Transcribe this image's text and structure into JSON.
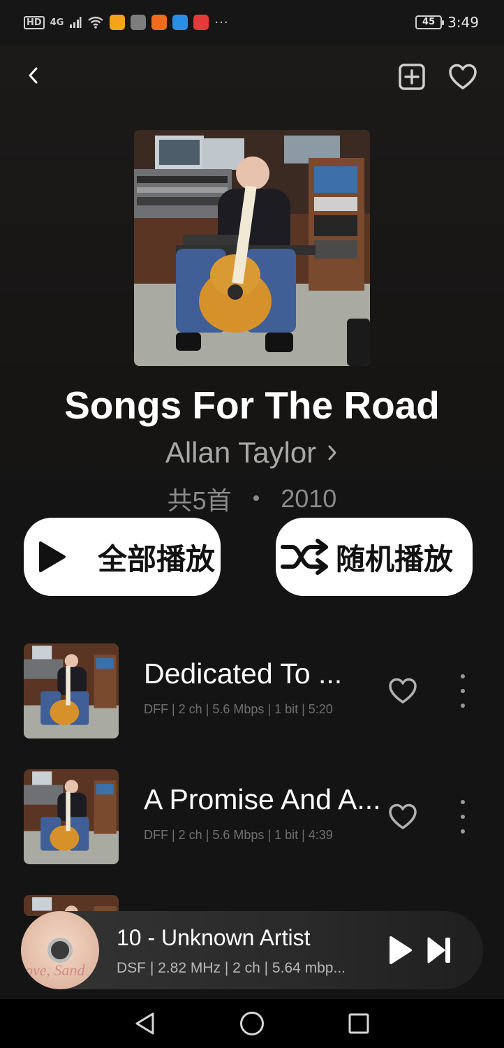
{
  "status_bar": {
    "network_tag": "HD",
    "signal": "4G",
    "battery": "45",
    "time": "3:49",
    "more": "···",
    "app_icon_colors": [
      "#f5a31a",
      "#7d7d7d",
      "#f26a1b",
      "#2b8ee6",
      "#e63a3a"
    ]
  },
  "album": {
    "title": "Songs For The Road",
    "artist": "Allan Taylor",
    "track_count": "共5首",
    "separator": "•",
    "year": "2010"
  },
  "actions": {
    "play_all": "全部播放",
    "shuffle": "随机播放"
  },
  "tracks": [
    {
      "title": "Dedicated To ...",
      "info": "DFF | 2 ch | 5.6 Mbps | 1 bit | 5:20"
    },
    {
      "title": "A Promise And A...",
      "info": "DFF | 2 ch | 5.6 Mbps | 1 bit | 4:39"
    }
  ],
  "now_playing": {
    "title": "10 - Unknown Artist",
    "info": "DSF | 2.82 MHz | 2 ch | 5.64 mbp...",
    "cover_text": "ove, Sand"
  },
  "icons": {
    "back": "chevron-left-icon",
    "add": "add-square-icon",
    "favorite": "heart-icon",
    "play": "play-icon",
    "shuffle": "shuffle-icon",
    "more": "more-vertical-icon",
    "next": "skip-next-icon",
    "nav_back": "triangle-back-icon",
    "nav_home": "circle-home-icon",
    "nav_recent": "square-recent-icon"
  }
}
